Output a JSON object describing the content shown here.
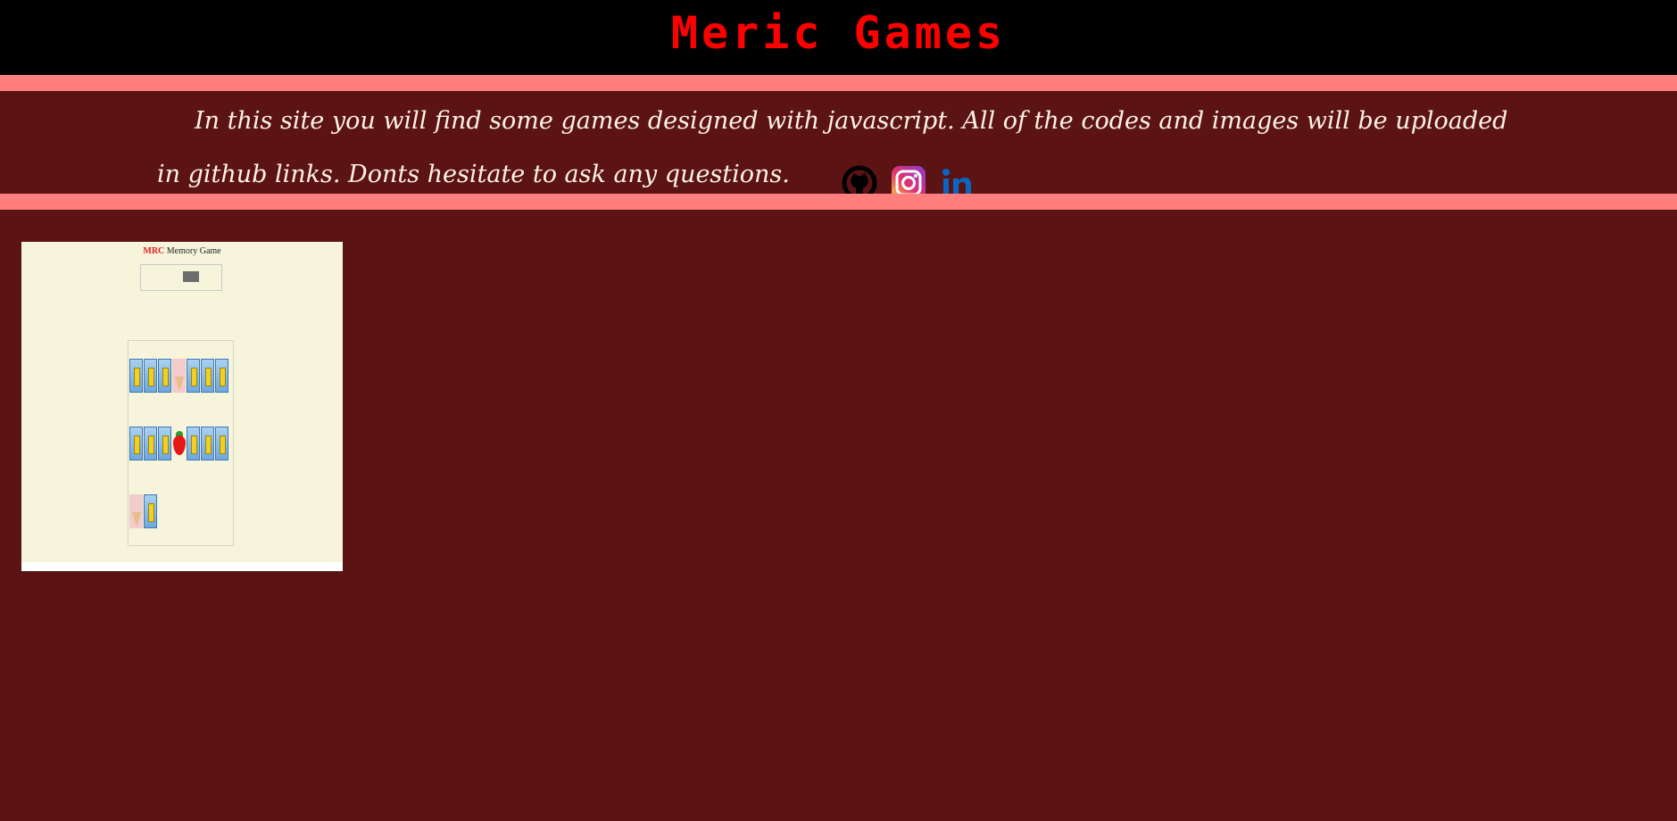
{
  "header": {
    "title": "Meric Games"
  },
  "intro": {
    "text": "In this site you will find some games designed with javascript. All of the codes and images will be uploaded in github links. Donts hesitate to ask any questions."
  },
  "social": [
    {
      "name": "github",
      "icon": "github-icon"
    },
    {
      "name": "instagram",
      "icon": "instagram-icon"
    },
    {
      "name": "linkedin",
      "icon": "linkedin-icon"
    }
  ],
  "games": [
    {
      "thumbnail_title_brand": "MRC",
      "thumbnail_title_rest": "Memory Game"
    }
  ],
  "colors": {
    "page_background": "#5c1313",
    "header_background": "#000000",
    "title": "#ff0000",
    "stripe": "#ff7f7f",
    "intro_text": "#fdf2e4"
  }
}
